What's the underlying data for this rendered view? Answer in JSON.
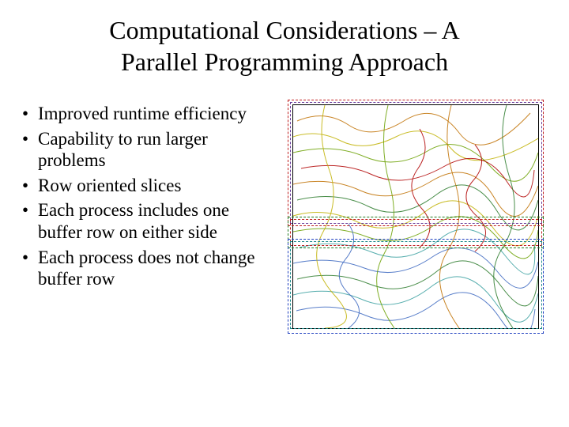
{
  "title_line1": "Computational Considerations – A",
  "title_line2": "Parallel Programming  Approach",
  "bullets": [
    "Improved runtime efficiency",
    "Capability to run larger problems",
    "Row oriented slices",
    "Each process includes one buffer row on either side",
    "Each process does not change buffer row"
  ],
  "figure": {
    "description": "Contour map partitioned into horizontal (row-oriented) slices with dashed overlap boundaries indicating buffer rows shared between adjacent processes.",
    "slice_colors": {
      "outer_top": "#c02020",
      "inner_top": "#6a3d9a",
      "outer_mid": "#1f7a1f",
      "inner_mid": "#c02020",
      "outer_bot": "#2040c0",
      "inner_bot": "#1e8b8b"
    },
    "contour_palette": [
      "#b00000",
      "#c07000",
      "#c0b000",
      "#6aa000",
      "#2a7a2a",
      "#3aa0a0",
      "#3a66c0"
    ]
  }
}
